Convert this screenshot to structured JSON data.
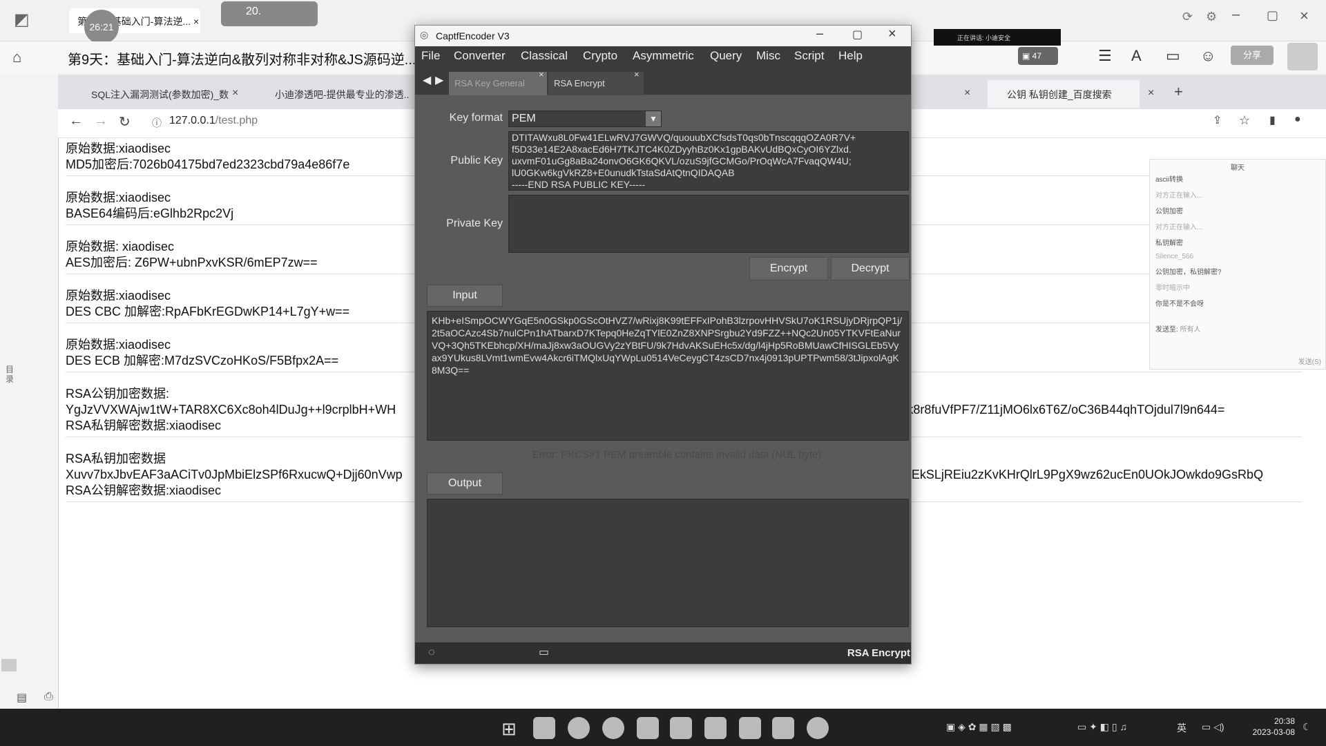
{
  "top": {
    "lesson_tab": "第9天：基础入门-算法逆...",
    "timer": "26:21",
    "perf_value": "20.",
    "lesson_title": "第9天：基础入门-算法逆向&散列对称非对称&JS源码逆...",
    "meeting": "正在讲话: 小迪安全",
    "notify_count": "47",
    "share_label": "分享"
  },
  "browser": {
    "tabs": [
      "SQL注入漏洞测试(参数加密)_数",
      "小迪渗透吧-提供最专业的渗透..",
      "公钥 私钥创建_百度搜索"
    ],
    "url_host": "127.0.0.1",
    "url_path": "/test.php",
    "blocks": [
      {
        "l1": "原始数据:xiaodisec",
        "l2": "MD5加密后:7026b04175bd7ed2323cbd79a4e86f7e"
      },
      {
        "l1": "原始数据:xiaodisec",
        "l2": "BASE64编码后:eGlhb2Rpc2Vj"
      },
      {
        "l1": "原始数据: xiaodisec",
        "l2": "AES加密后: Z6PW+ubnPxvKSR/6mEP7zw=="
      },
      {
        "l1": "原始数据:xiaodisec",
        "l2": "DES CBC 加解密:RpAFbKrEGDwKP14+L7gY+w=="
      },
      {
        "l1": "原始数据:xiaodisec",
        "l2": "DES ECB 加解密:M7dzSVCzoHKoS/F5Bfpx2A=="
      },
      {
        "l1": "RSA公钥加密数据:",
        "l2": "YgJzVVXWAjw1tW+TAR8XC6Xc8oh4lDuJg++l9crplbH+WH                                                                                                                                   NZm6J2Etk8r8fuVfPF7/Z11jMO6lx6T6Z/oC36B44qhTOjdul7l9n644=",
        "l3": "RSA私钥解密数据:xiaodisec"
      },
      {
        "l1": "RSA私钥加密数据",
        "l2": "Xuvv7bxJbvEAF3aACiTv0JpMbiElzSPf6RxucwQ+Djj60nVwp                                                                                                                                   ozykRE08EkSLjREiu2zKvKHrQlrL9PgX9wz62ucEn0UOkJOwkdo9GsRbQ",
        "l3": "RSA公钥解密数据:xiaodisec"
      }
    ]
  },
  "chat": {
    "header": "聊天",
    "messages": [
      "ascii转换",
      "对方正在输入...",
      "公钥加密",
      "对方正在输入...",
      "私钥解密",
      "Silence_566",
      "公钥加密，私钥解密?",
      "零时暗示中",
      "你是不是不会呀"
    ],
    "send_to": "发送至:",
    "recipient": "所有人",
    "send_btn": "发送(S)"
  },
  "encoder": {
    "title": "CaptfEncoder V3",
    "menu": [
      "File",
      "Converter",
      "Classical",
      "Crypto",
      "Asymmetric",
      "Query",
      "Misc",
      "Script",
      "Help"
    ],
    "tabs": [
      "RSA Key General",
      "RSA Encrypt"
    ],
    "key_format_label": "Key format",
    "key_format_value": "PEM",
    "public_key_label": "Public Key",
    "public_key_value": "DTITAWxu8L0Fw41ELwRVJ7GWVQ/quouubXCfsdsT0qs0bTnscqqqOZA0R7V+\nf5D33e14E2A8xacEd6H7TKJTC4K0ZDyyhBz0Kx1gpBAKvUdBQxCyOI6YZlxd.\nuxvmF01uGg8aBa24onvO6GK6QKVL/ozuS9jfGCMGo/PrOqWcA7FvaqQW4U;\nlU0GKw6kgVkRZ8+E0unudkTstaSdAtQtnQIDAQAB\n-----END RSA PUBLIC KEY-----",
    "private_key_label": "Private Key",
    "private_key_value": "",
    "encrypt_btn": "Encrypt",
    "decrypt_btn": "Decrypt",
    "input_btn": "Input",
    "input_value": "KHb+eISmpOCWYGqE5n0GSkp0GScOtHVZ7/wRixj8K99tEFFxIPohB3lzrpovHHVSkU7oK1RSUjyDRjrpQP1j/2t5aOCAzc4Sb7nulCPn1hATbarxD7KTepq0HeZqTYlE0ZnZ8XNPSrgbu2Yd9FZZ++NQc2Un05YTKVFtEaNurVQ+3Qh5TKEbhcp/XH/maJj8xw3aOUGVy2zYBtFU/9k7HdvAKSuEHc5x/dg/l4jHp5RoBMUawCfHISGLEb5Vyax9YUkus8LVmt1wmEvw4Akcr6iTMQlxUqYWpLu0514VeCeygCT4zsCD7nx4j0913pUPTPwm58/3tJipxolAgK8M3Q==",
    "error": "Error: PKCS#1 PEM preamble contains invalid data (NUL byte)",
    "output_btn": "Output",
    "output_value": "",
    "status_right": "RSA Encrypt"
  },
  "taskbar": {
    "time": "20:38",
    "date": "2023-03-08",
    "lang": "英"
  }
}
